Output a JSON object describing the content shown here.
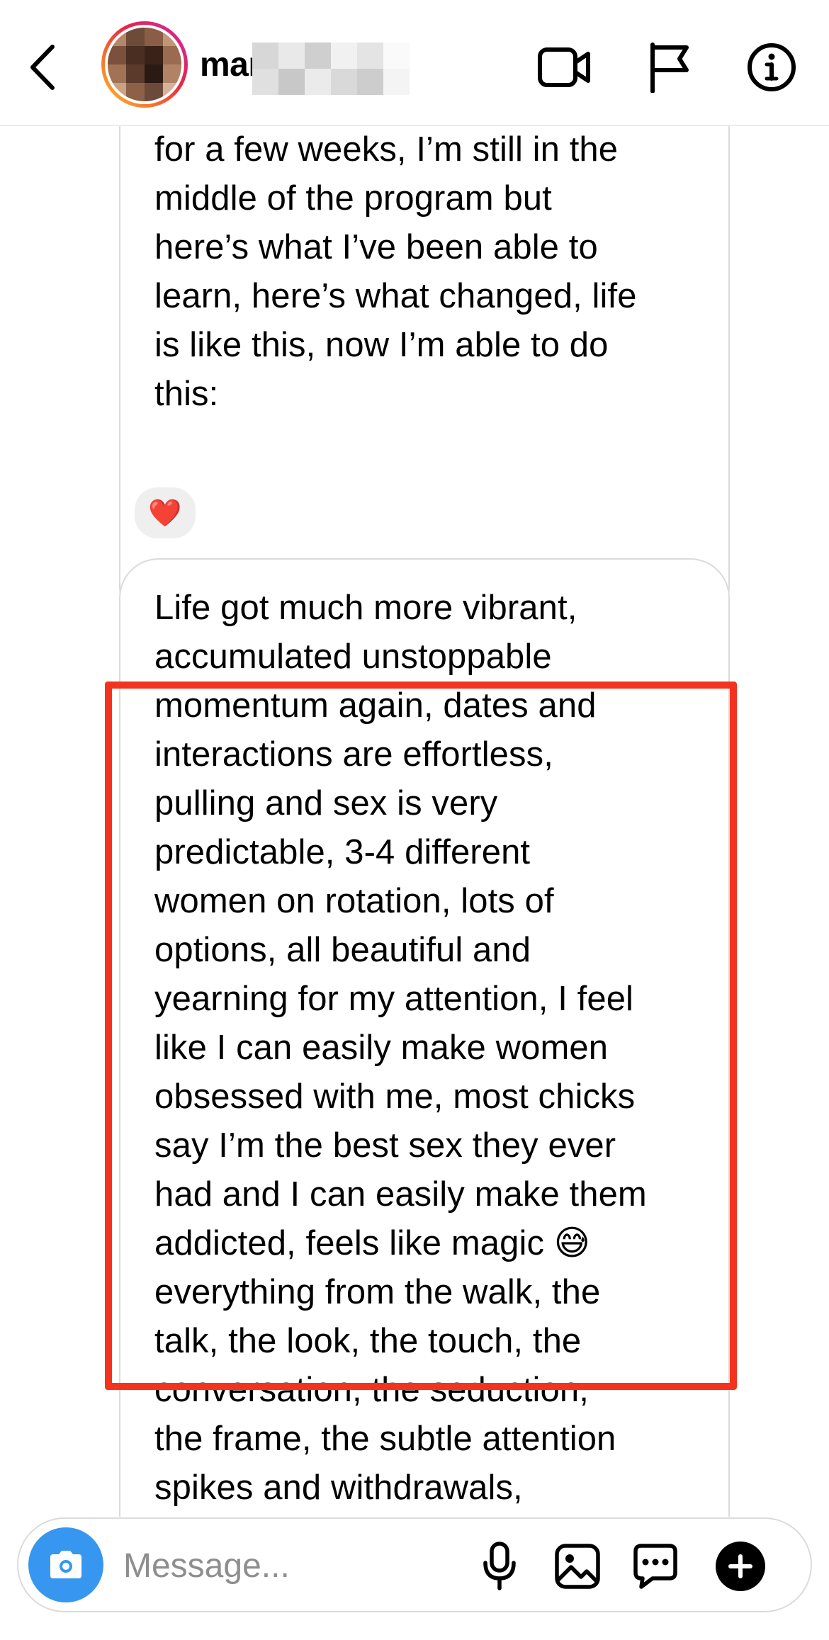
{
  "header": {
    "username_visible": "mar",
    "icons": [
      "back-chevron-icon",
      "video-call-icon",
      "report-flag-icon",
      "info-icon"
    ]
  },
  "messages": [
    {
      "text": "Now after working with Limo\nfor a few weeks, I’m still in the\nmiddle of the program but\nhere’s what I’ve been able to\nlearn, here’s what changed, life\nis like this, now I’m able to do\nthis:",
      "reaction": "❤️"
    },
    {
      "text": "Life got much more vibrant,\naccumulated unstoppable\nmomentum again, dates and\ninteractions are effortless,\npulling and sex is very\npredictable, 3-4 different\nwomen on rotation, lots of\noptions, all beautiful and\nyearning for my attention, I feel\nlike I can easily make women\nobsessed with me, most chicks\nsay I’m the best sex they ever\nhad and I can easily make them\naddicted, feels like magic 😅\neverything from the walk, the\ntalk, the look, the touch, the\nconversation, the seduction,\nthe frame, the subtle attention\nspikes and withdrawals,",
      "highlighted": true
    }
  ],
  "composer": {
    "placeholder": "Message...",
    "icons": [
      "camera-icon",
      "microphone-icon",
      "gallery-icon",
      "chat-bubble-icon",
      "plus-icon"
    ]
  },
  "colors": {
    "highlight_border": "#f4331e",
    "camera_button": "#3797f0",
    "reaction_bg": "#efefef",
    "bubble_border": "#dbdbdb",
    "placeholder": "#8e8e8e"
  }
}
